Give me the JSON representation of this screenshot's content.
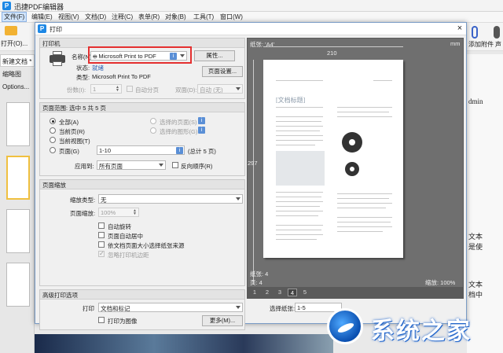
{
  "app": {
    "title": "迅捷PDF编辑器",
    "logo": "P",
    "menu": [
      "文件(F)",
      "编辑(E)",
      "视图(V)",
      "文档(D)",
      "注释(C)",
      "表单(R)",
      "对象(B)",
      "工具(T)",
      "窗口(W)"
    ],
    "toolbar": {
      "open_label": "打开(O)...",
      "attach_label": "添加附件",
      "extra_label": "声"
    },
    "doc_tab": "新建文档 *",
    "left_panel": {
      "thumbnails_label": "缩略图",
      "options_label": "Options..."
    },
    "right_text": [
      "dmin",
      "文本",
      "是使",
      "文本",
      "档中"
    ]
  },
  "dialog": {
    "title": "打印",
    "close_symbol": "×",
    "printer": {
      "section_title": "打印机",
      "name_label": "名称(N)",
      "name_value": "Microsoft Print to PDF",
      "properties_button": "属性...",
      "status_label": "状态:",
      "status_value": "就绪",
      "type_label": "类型:",
      "type_value": "Microsoft Print To PDF",
      "page_setup_button": "页面设置...",
      "copies_label": "份数(I):",
      "copies_value": "1",
      "collate_label": "自动分页",
      "duplex_label": "双面(D):",
      "duplex_value": "自动 (无)"
    },
    "range": {
      "section_title": "页面范围: 选中 5 共 5 页",
      "all_label": "全部(A)",
      "current_page_label": "当前页(R)",
      "current_view_label": "当前视图(T)",
      "pages_label": "页面(G)",
      "pages_value": "1-10",
      "pages_total": "(总计 5 页)",
      "selected_pages_label": "选择的页面(S)",
      "selected_graphics_label": "选择的图形(G)",
      "apply_label": "应用到:",
      "apply_value": "所有页面",
      "reverse_label": "反向顺序(R)"
    },
    "scaling": {
      "section_title": "页面缩放",
      "type_label": "缩放类型:",
      "type_value": "无",
      "zoom_label": "页面缩放:",
      "zoom_value": "100%",
      "auto_rotate_label": "自动旋转",
      "auto_center_label": "页面自动居中",
      "by_size_label": "依文档页面大小选择纸张来源",
      "ignore_margins_label": "忽略打印机边距"
    },
    "advanced": {
      "section_title": "高级打印选项",
      "print_label": "打印",
      "print_value": "文档和标记",
      "as_image_label": "打印为图像",
      "more_button": "更多(M)..."
    },
    "preview": {
      "paper_label": "纸张: 'A4'",
      "unit": "mm",
      "width": "210",
      "height": "297",
      "paper_info": "纸张: 4",
      "page_info": "页: 4",
      "zoom_info": "缩放: 100%",
      "doc_title": "[文档标题]",
      "pages": [
        "1",
        "2",
        "3",
        "4",
        "5"
      ],
      "current_page": "4"
    },
    "select_paper_label": "选择纸张:",
    "select_paper_value": "1-5"
  },
  "watermark": {
    "text": "系统之家"
  },
  "colors": {
    "accent": "#1e88e5",
    "highlight": "#e43030",
    "link": "#2b5fb2"
  }
}
